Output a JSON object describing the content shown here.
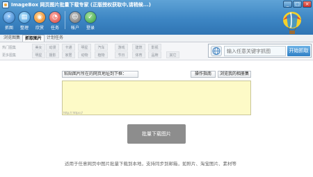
{
  "app": {
    "title": "ImageBox 网页图片批量下载专家 (正版授权获取中,请稍候...)"
  },
  "window_buttons": {
    "minimize": "_",
    "maximize": "□",
    "close": "×"
  },
  "toolbar": {
    "items": [
      {
        "label": "抓图",
        "icon": "capture-icon"
      },
      {
        "label": "整理",
        "icon": "organize-icon"
      },
      {
        "label": "欣赏",
        "icon": "view-icon"
      },
      {
        "label": "任务",
        "icon": "task-icon"
      },
      {
        "label": "帐户",
        "icon": "account-icon"
      },
      {
        "label": "登录",
        "icon": "login-icon"
      }
    ]
  },
  "tabs": [
    {
      "label": "浏览图集",
      "active": false
    },
    {
      "label": "抓取图片",
      "active": true
    },
    {
      "label": "计划任务",
      "active": false
    }
  ],
  "categories": {
    "label_row1": "热门图集",
    "label_row2": "更多图集",
    "row1": [
      "美女",
      "动漫",
      "卡通",
      "明星",
      "汽车",
      "游戏",
      "建筑",
      "影视"
    ],
    "row2": [
      "明星",
      "摄影",
      "家居",
      "动物",
      "植物",
      "节日",
      "体育",
      "品牌",
      "其它"
    ]
  },
  "search": {
    "placeholder": "输入任意关键字抓图",
    "button": "开始抓取",
    "icon": "globe-icon"
  },
  "main": {
    "paste_label": "粘贴图片所在的网页地址到下框：",
    "guide_button": "操作指南",
    "history_button": "浏览我的相册集",
    "url_hint": "http:// https://",
    "download_button": "批量下载图片",
    "footer": "适用于任意网页中图片批量下载到本地，支持同步到邮箱，如照片、淘宝图片、素材等"
  },
  "colors": {
    "header_blue": "#3d86c4",
    "url_area_bg": "#fdfac7",
    "download_button_bg": "#8d8d8d"
  }
}
